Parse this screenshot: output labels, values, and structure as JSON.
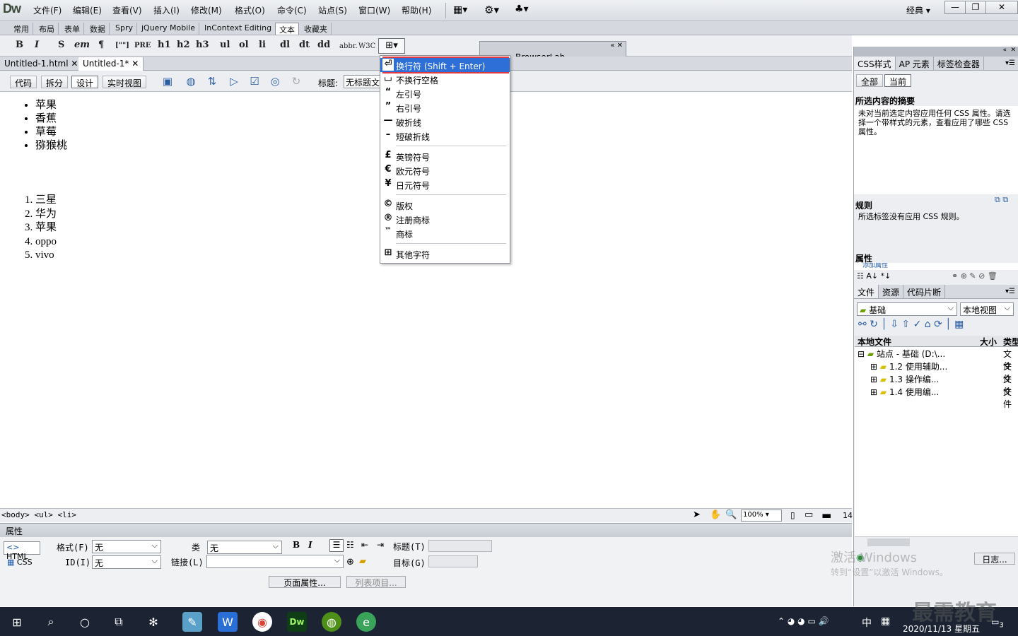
{
  "app": {
    "logo": "Dw",
    "workspace": "经典"
  },
  "menu": [
    "文件(F)",
    "编辑(E)",
    "查看(V)",
    "插入(I)",
    "修改(M)",
    "格式(O)",
    "命令(C)",
    "站点(S)",
    "窗口(W)",
    "帮助(H)"
  ],
  "insert_tabs": [
    "常用",
    "布局",
    "表单",
    "数据",
    "Spry",
    "jQuery Mobile",
    "InContext Editing",
    "文本",
    "收藏夹"
  ],
  "text_toolbar": {
    "bold": "B",
    "italic": "I",
    "strong": "S",
    "em": "em",
    "para": "¶",
    "quote": "[\"\"]",
    "pre": "PRE",
    "h1": "h1",
    "h2": "h2",
    "h3": "h3",
    "ul": "ul",
    "ol": "ol",
    "li": "li",
    "dl": "dl",
    "dt": "dt",
    "dd": "dd",
    "abbr": "abbr.",
    "w3c": "W3C"
  },
  "browserlab": "BrowserLab",
  "doc_tabs": [
    {
      "label": "Untitled-1.html"
    },
    {
      "label": "Untitled-1*"
    }
  ],
  "view_buttons": [
    "代码",
    "拆分",
    "设计",
    "实时视图"
  ],
  "title_label": "标题:",
  "title_value": "无标题文",
  "unordered_list": [
    "苹果",
    "香蕉",
    "草莓",
    "猕猴桃"
  ],
  "ordered_list": [
    "三星",
    "华为",
    "苹果",
    "oppo",
    "vivo"
  ],
  "status": {
    "tags": "<body> <ul> <li>",
    "zoom": "100%",
    "size": "14"
  },
  "dropdown": [
    {
      "label": "换行符 (Shift + Enter)",
      "icon": "line-break-icon",
      "glyph": "⏎"
    },
    {
      "label": "不换行空格",
      "icon": "nbsp-icon",
      "glyph": "⌴"
    },
    {
      "label": "左引号",
      "icon": "left-quote-icon",
      "glyph": "“"
    },
    {
      "label": "右引号",
      "icon": "right-quote-icon",
      "glyph": "”"
    },
    {
      "label": "破折线",
      "icon": "em-dash-icon",
      "glyph": "—"
    },
    {
      "label": "短破折线",
      "icon": "en-dash-icon",
      "glyph": "–"
    },
    {
      "label": "英镑符号",
      "icon": "pound-icon",
      "glyph": "£"
    },
    {
      "label": "欧元符号",
      "icon": "euro-icon",
      "glyph": "€"
    },
    {
      "label": "日元符号",
      "icon": "yen-icon",
      "glyph": "¥"
    },
    {
      "label": "版权",
      "icon": "copyright-icon",
      "glyph": "©"
    },
    {
      "label": "注册商标",
      "icon": "registered-icon",
      "glyph": "®"
    },
    {
      "label": "商标",
      "icon": "trademark-icon",
      "glyph": "™"
    },
    {
      "label": "其他字符",
      "icon": "other-chars-icon",
      "glyph": "⊞"
    }
  ],
  "properties": {
    "title": "属性",
    "html_btn": "HTML",
    "css_btn": "CSS",
    "format_label": "格式(F)",
    "format_value": "无",
    "id_label": "ID(I)",
    "id_value": "无",
    "class_label": "类",
    "class_value": "无",
    "link_label": "链接(L)",
    "bold": "B",
    "italic": "I",
    "title_label": "标题(T)",
    "target_label": "目标(G)",
    "page_props_btn": "页面属性...",
    "list_item_btn": "列表项目..."
  },
  "css_panel": {
    "tabs": [
      "CSS样式",
      "AP 元素",
      "标签检查器"
    ],
    "mode_buttons": [
      "全部",
      "当前"
    ],
    "summary_title": "所选内容的摘要",
    "summary_text": "未对当前选定内容应用任何 CSS 属性。请选择一个带样式的元素，查看应用了哪些 CSS 属性。",
    "rules_title": "规则",
    "rules_text": "所选标签没有应用 CSS 规则。",
    "props_title": "属性",
    "add_prop": "添加属性"
  },
  "files_panel": {
    "tabs": [
      "文件",
      "资源",
      "代码片断"
    ],
    "site": "基础",
    "view": "本地视图",
    "col_local": "本地文件",
    "col_size": "大小",
    "col_type": "类型",
    "root": "站点 - 基础 (D:\\...",
    "root_type": "文件",
    "items": [
      {
        "name": "1.2 使用辅助...",
        "type": "文件"
      },
      {
        "name": "1.3 操作编...",
        "type": "文件"
      },
      {
        "name": "1.4 使用编...",
        "type": "文件"
      }
    ],
    "log_btn": "日志..."
  },
  "watermark": {
    "line1": "激活 Windows",
    "line2": "转到“设置”以激活 Windows。",
    "brand": "最需教育"
  },
  "taskbar": {
    "ime": "中",
    "datetime": "2020/11/13 星期五",
    "notifications": "3"
  }
}
